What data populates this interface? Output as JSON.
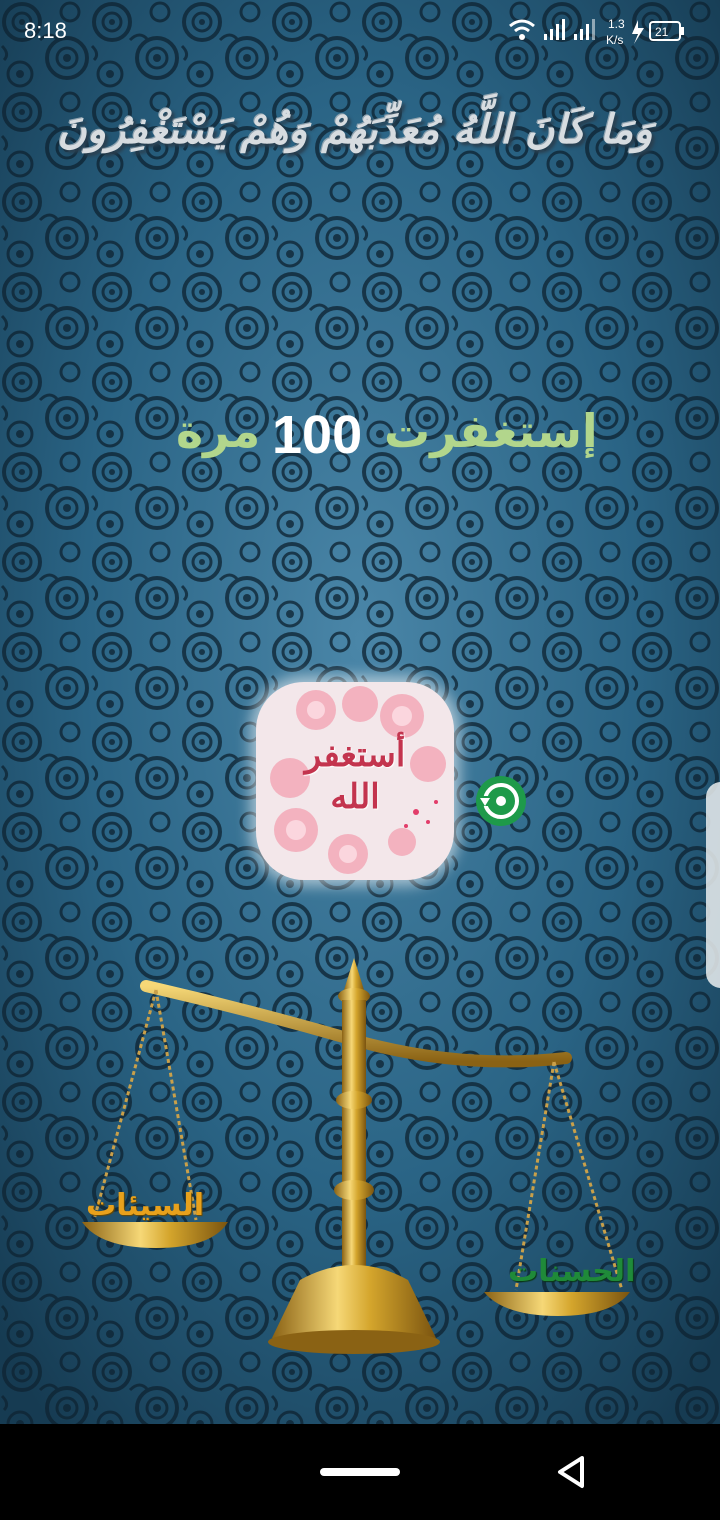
{
  "status_bar": {
    "time": "8:18",
    "net_speed_value": "1.3",
    "net_speed_unit": "K/s",
    "battery_level": "21"
  },
  "verse": "وَمَا كَانَ اللَّهُ مُعَذِّبَهُمْ وَهُمْ يَسْتَغْفِرُونَ",
  "counter": {
    "prefix": "إستغفرت",
    "value": "100",
    "suffix": "مرة"
  },
  "istighfar_button": {
    "label_line1": "أستغفر",
    "label_line2": "الله"
  },
  "scale": {
    "sins_label": "السيئات",
    "good_deeds_label": "الحسنات"
  },
  "colors": {
    "background": "#1d5776",
    "accent_green": "#b2d68c",
    "reset_green": "#1e9a4a",
    "sins_orange": "#e8a11c",
    "deeds_green": "#1f8a39",
    "gold": "#d4a52c"
  },
  "icons": {
    "reset": "reset-icon",
    "back": "back-triangle-icon",
    "wifi": "wifi-icon",
    "signal": "signal-icon",
    "battery": "battery-icon"
  }
}
